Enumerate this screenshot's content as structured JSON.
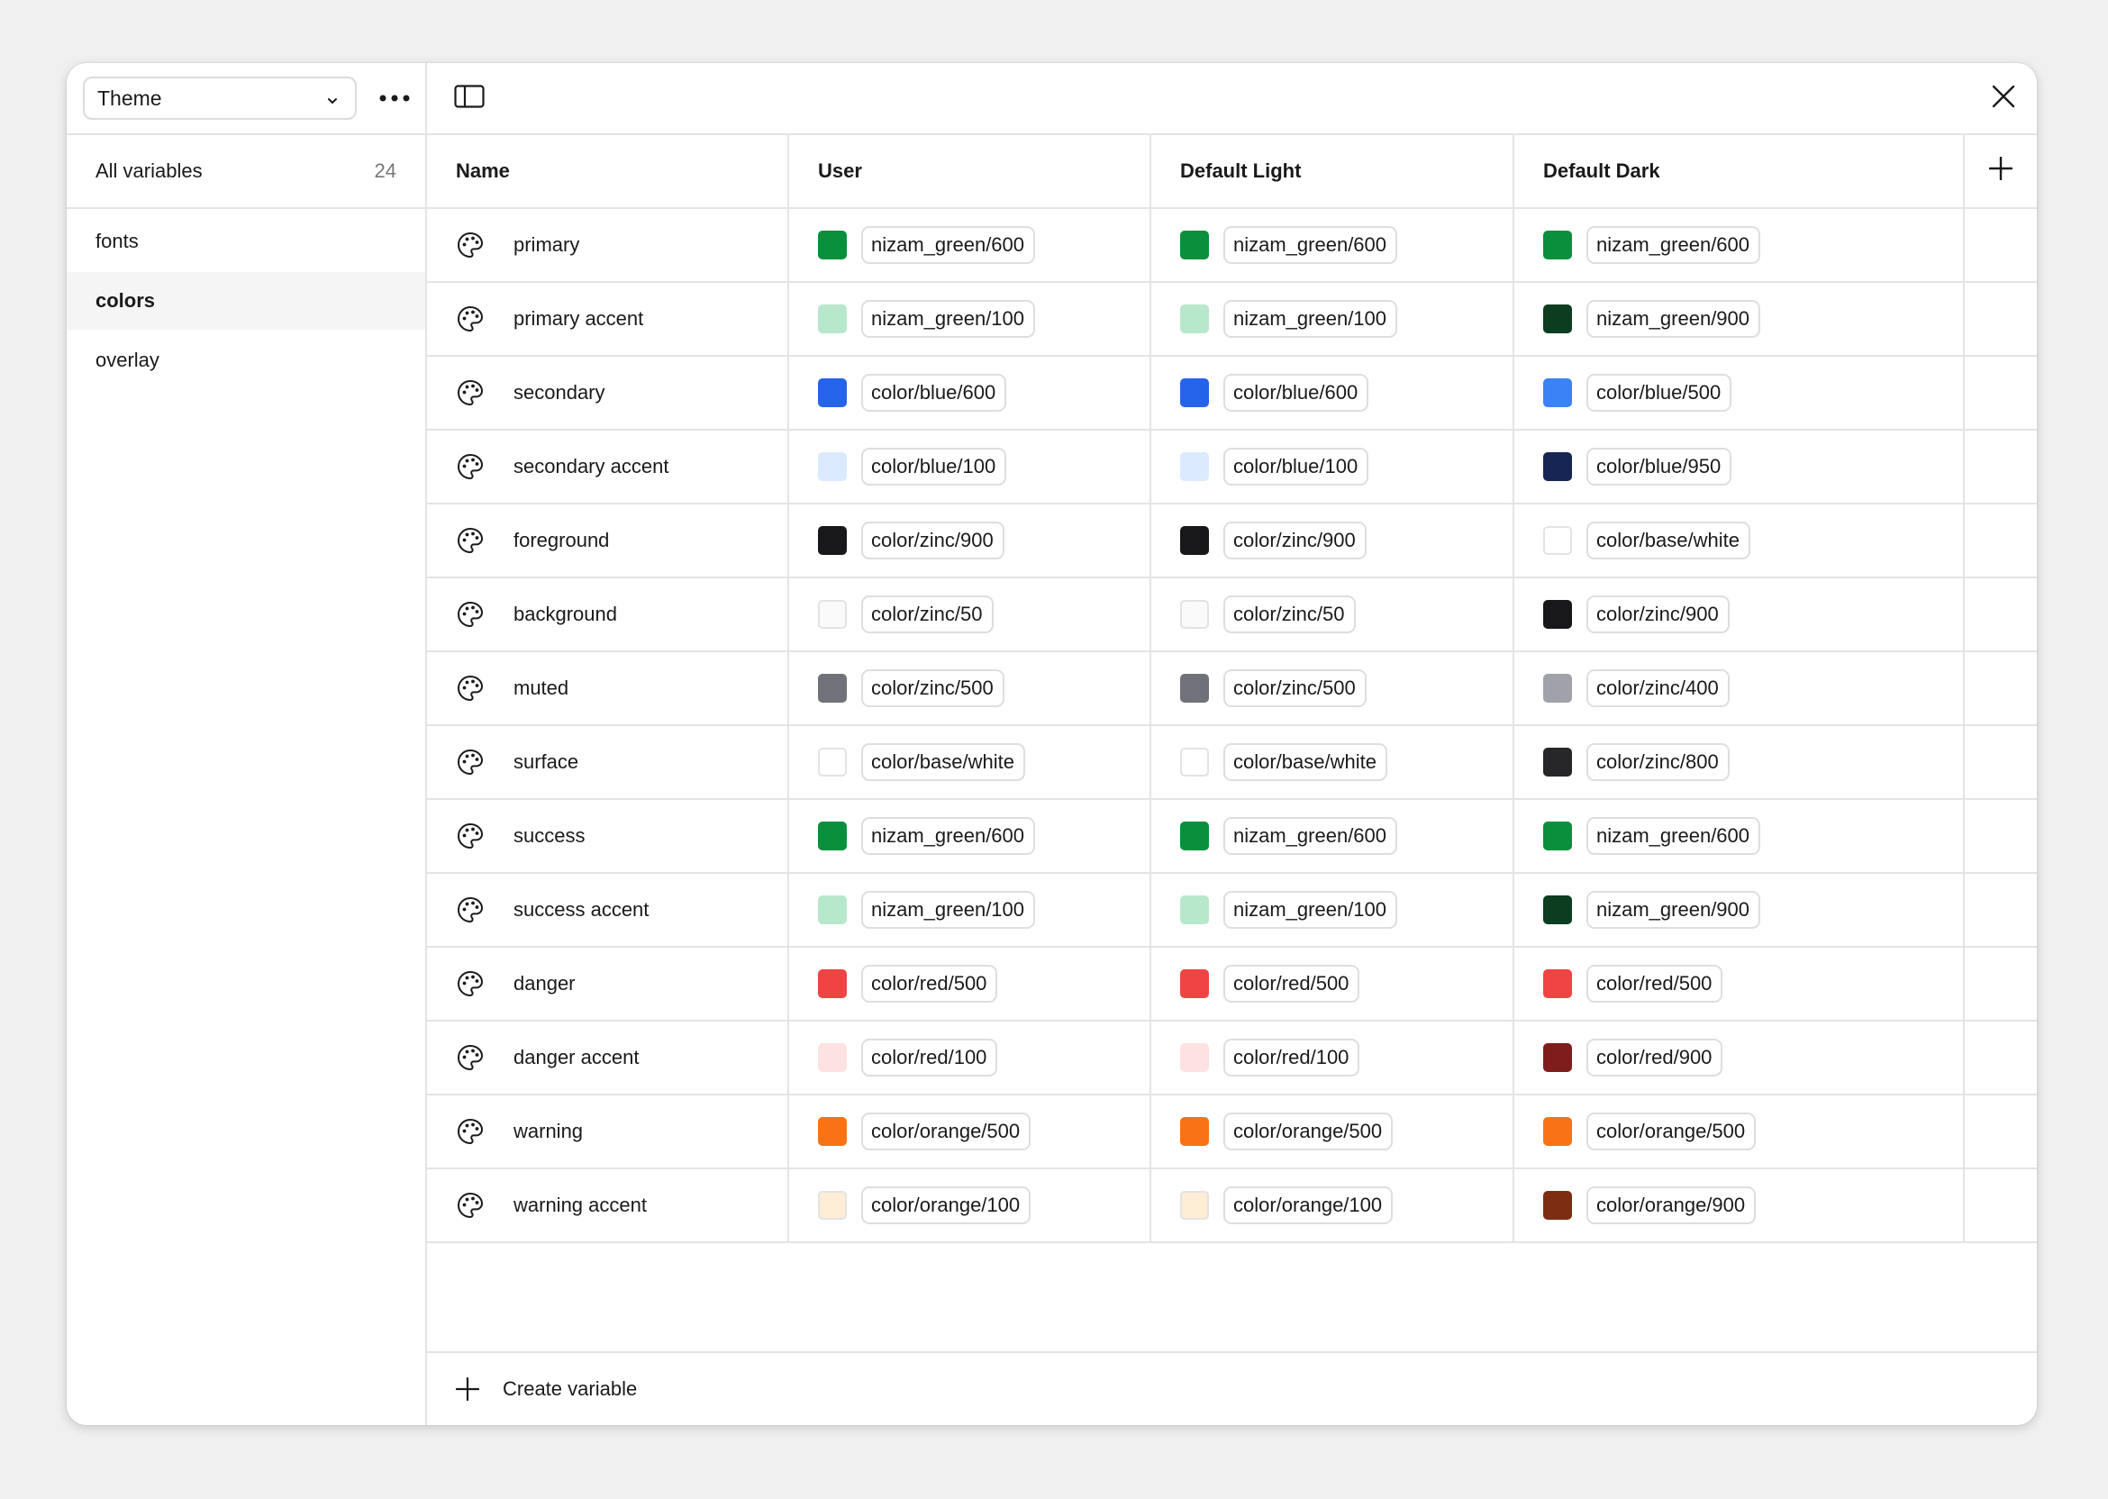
{
  "sidebar": {
    "collection": "Theme",
    "all_variables_label": "All variables",
    "all_variables_count": "24",
    "groups": [
      {
        "label": "fonts",
        "active": false
      },
      {
        "label": "colors",
        "active": true
      },
      {
        "label": "overlay",
        "active": false
      }
    ]
  },
  "table": {
    "headers": {
      "name": "Name",
      "user": "User",
      "light": "Default Light",
      "dark": "Default Dark"
    },
    "rows": [
      {
        "name": "primary",
        "user": {
          "value": "nizam_green/600",
          "color": "#0a8f3c"
        },
        "light": {
          "value": "nizam_green/600",
          "color": "#0a8f3c"
        },
        "dark": {
          "value": "nizam_green/600",
          "color": "#0a8f3c"
        }
      },
      {
        "name": "primary accent",
        "user": {
          "value": "nizam_green/100",
          "color": "#b8e8cc"
        },
        "light": {
          "value": "nizam_green/100",
          "color": "#b8e8cc"
        },
        "dark": {
          "value": "nizam_green/900",
          "color": "#0b3d21"
        }
      },
      {
        "name": "secondary",
        "user": {
          "value": "color/blue/600",
          "color": "#2563eb"
        },
        "light": {
          "value": "color/blue/600",
          "color": "#2563eb"
        },
        "dark": {
          "value": "color/blue/500",
          "color": "#3b82f6"
        }
      },
      {
        "name": "secondary accent",
        "user": {
          "value": "color/blue/100",
          "color": "#dbeafe"
        },
        "light": {
          "value": "color/blue/100",
          "color": "#dbeafe"
        },
        "dark": {
          "value": "color/blue/950",
          "color": "#172554"
        }
      },
      {
        "name": "foreground",
        "user": {
          "value": "color/zinc/900",
          "color": "#18181b"
        },
        "light": {
          "value": "color/zinc/900",
          "color": "#18181b"
        },
        "dark": {
          "value": "color/base/white",
          "color": "#ffffff"
        }
      },
      {
        "name": "background",
        "user": {
          "value": "color/zinc/50",
          "color": "#fafafa"
        },
        "light": {
          "value": "color/zinc/50",
          "color": "#fafafa"
        },
        "dark": {
          "value": "color/zinc/900",
          "color": "#18181b"
        }
      },
      {
        "name": "muted",
        "user": {
          "value": "color/zinc/500",
          "color": "#71717a"
        },
        "light": {
          "value": "color/zinc/500",
          "color": "#71717a"
        },
        "dark": {
          "value": "color/zinc/400",
          "color": "#a1a1aa"
        }
      },
      {
        "name": "surface",
        "user": {
          "value": "color/base/white",
          "color": "#ffffff"
        },
        "light": {
          "value": "color/base/white",
          "color": "#ffffff"
        },
        "dark": {
          "value": "color/zinc/800",
          "color": "#27272a"
        }
      },
      {
        "name": "success",
        "user": {
          "value": "nizam_green/600",
          "color": "#0a8f3c"
        },
        "light": {
          "value": "nizam_green/600",
          "color": "#0a8f3c"
        },
        "dark": {
          "value": "nizam_green/600",
          "color": "#0a8f3c"
        }
      },
      {
        "name": "success accent",
        "user": {
          "value": "nizam_green/100",
          "color": "#b8e8cc"
        },
        "light": {
          "value": "nizam_green/100",
          "color": "#b8e8cc"
        },
        "dark": {
          "value": "nizam_green/900",
          "color": "#0b3d21"
        }
      },
      {
        "name": "danger",
        "user": {
          "value": "color/red/500",
          "color": "#ef4444"
        },
        "light": {
          "value": "color/red/500",
          "color": "#ef4444"
        },
        "dark": {
          "value": "color/red/500",
          "color": "#ef4444"
        }
      },
      {
        "name": "danger accent",
        "user": {
          "value": "color/red/100",
          "color": "#fee2e2"
        },
        "light": {
          "value": "color/red/100",
          "color": "#fee2e2"
        },
        "dark": {
          "value": "color/red/900",
          "color": "#7f1d1d"
        }
      },
      {
        "name": "warning",
        "user": {
          "value": "color/orange/500",
          "color": "#f97316"
        },
        "light": {
          "value": "color/orange/500",
          "color": "#f97316"
        },
        "dark": {
          "value": "color/orange/500",
          "color": "#f97316"
        }
      },
      {
        "name": "warning accent",
        "user": {
          "value": "color/orange/100",
          "color": "#ffedd5"
        },
        "light": {
          "value": "color/orange/100",
          "color": "#ffedd5"
        },
        "dark": {
          "value": "color/orange/900",
          "color": "#7c2d12"
        }
      }
    ]
  },
  "footer": {
    "create_label": "Create variable"
  },
  "icons": {
    "collection_dropdown": "chevron-down-icon",
    "more": "more-horizontal-icon",
    "toggle_sidebar": "sidebar-toggle-icon",
    "close": "close-icon",
    "add_mode": "plus-icon",
    "variable_type": "palette-icon",
    "create": "plus-icon"
  }
}
